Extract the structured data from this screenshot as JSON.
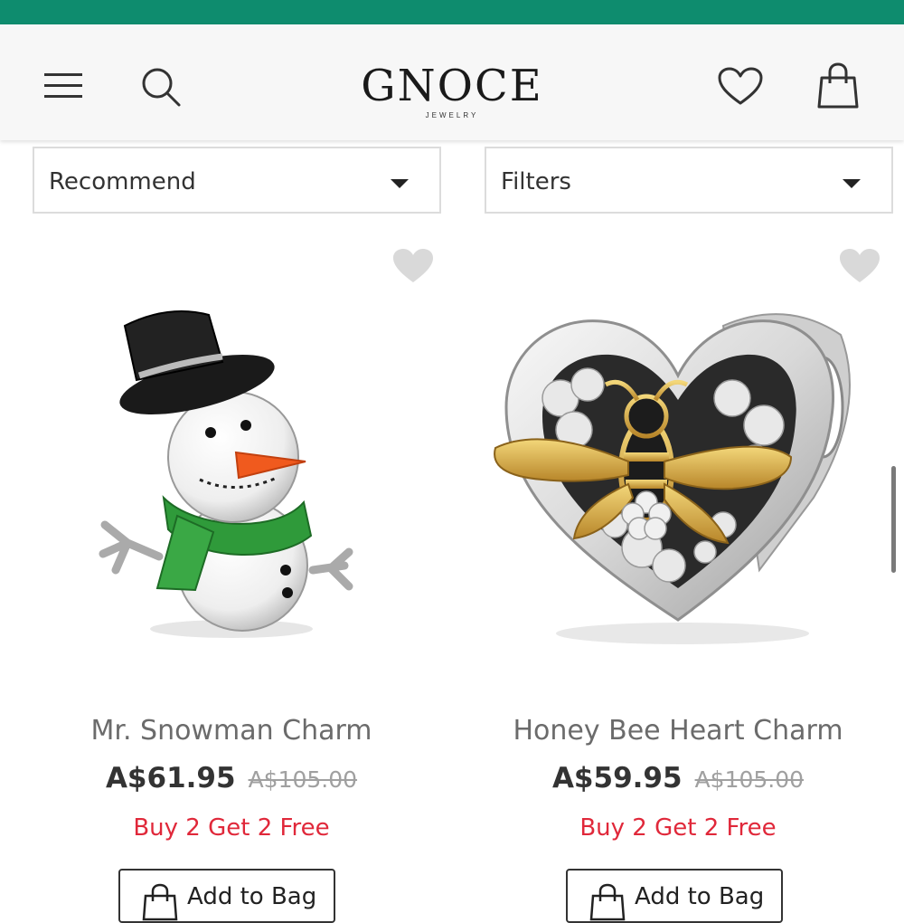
{
  "header": {
    "brand": "GNOCE",
    "brand_sub": "JEWELRY",
    "icons": {
      "menu": "menu-icon",
      "search": "search-icon",
      "wishlist": "heart-icon",
      "bag": "shopping-bag-icon"
    }
  },
  "toolbar": {
    "sort_label": "Recommend",
    "filter_label": "Filters"
  },
  "products": [
    {
      "name": "Mr. Snowman Charm",
      "price": "A$61.95",
      "original_price": "A$105.00",
      "promo": "Buy 2 Get 2 Free",
      "button_label": "Add to Bag"
    },
    {
      "name": "Honey Bee Heart Charm",
      "price": "A$59.95",
      "original_price": "A$105.00",
      "promo": "Buy 2 Get 2 Free",
      "button_label": "Add to Bag"
    }
  ],
  "colors": {
    "top_bar": "#0e8c6e",
    "promo_text": "#e0283a",
    "price_text": "#333333",
    "wishlist_heart": "#d9d9d9"
  }
}
